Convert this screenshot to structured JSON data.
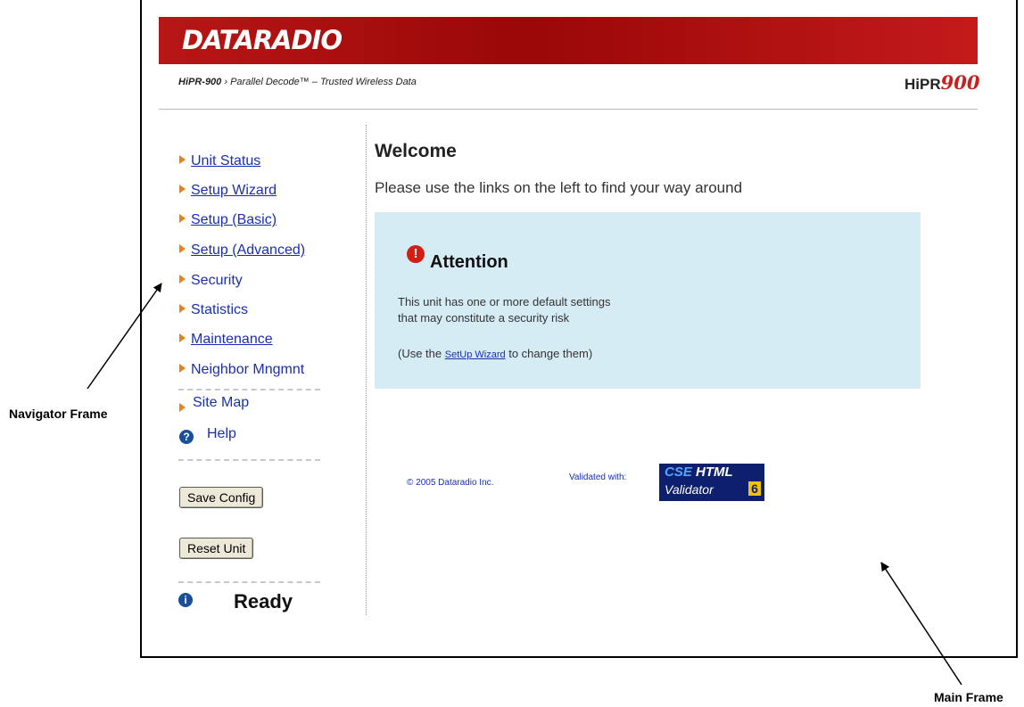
{
  "header": {
    "brand": "DATARADIO",
    "product": "HiPR-900",
    "tagline": "› Parallel Decode™ – Trusted Wireless Data",
    "logo_prefix": "HiPR",
    "logo_number": "900"
  },
  "nav": {
    "items": [
      {
        "label": "Unit Status"
      },
      {
        "label": "Setup Wizard"
      },
      {
        "label": "Setup (Basic)"
      },
      {
        "label": "Setup (Advanced)"
      },
      {
        "label": "Security"
      },
      {
        "label": "Statistics"
      },
      {
        "label": "Maintenance"
      },
      {
        "label": "Neighbor Mngmnt"
      }
    ],
    "site_map": "Site Map",
    "help": "Help",
    "save_button": "Save Config",
    "reset_button": "Reset Unit",
    "status": "Ready"
  },
  "main": {
    "title": "Welcome",
    "intro": "Please use the links on the left to find your way around",
    "attention": {
      "title": "Attention",
      "line1": "This unit has one or more default settings",
      "line2": "that may constitute a security risk",
      "line3_prefix": "(Use the ",
      "line3_link": "SetUp Wizard",
      "line3_suffix": " to change them)"
    },
    "copyright": "© 2005 Dataradio Inc.",
    "validated_label": "Validated with:",
    "validator": {
      "cse": "CSE",
      "html": "HTML",
      "name": "Validator",
      "version": "6"
    }
  },
  "callouts": {
    "navigator": "Navigator Frame",
    "main": "Main Frame"
  },
  "colors": {
    "brand_red": "#a50a0a",
    "link_blue": "#1a2fb0",
    "nav_arrow": "#e8811a",
    "attention_bg": "#d6ecf5",
    "alert_red": "#d21f16"
  }
}
